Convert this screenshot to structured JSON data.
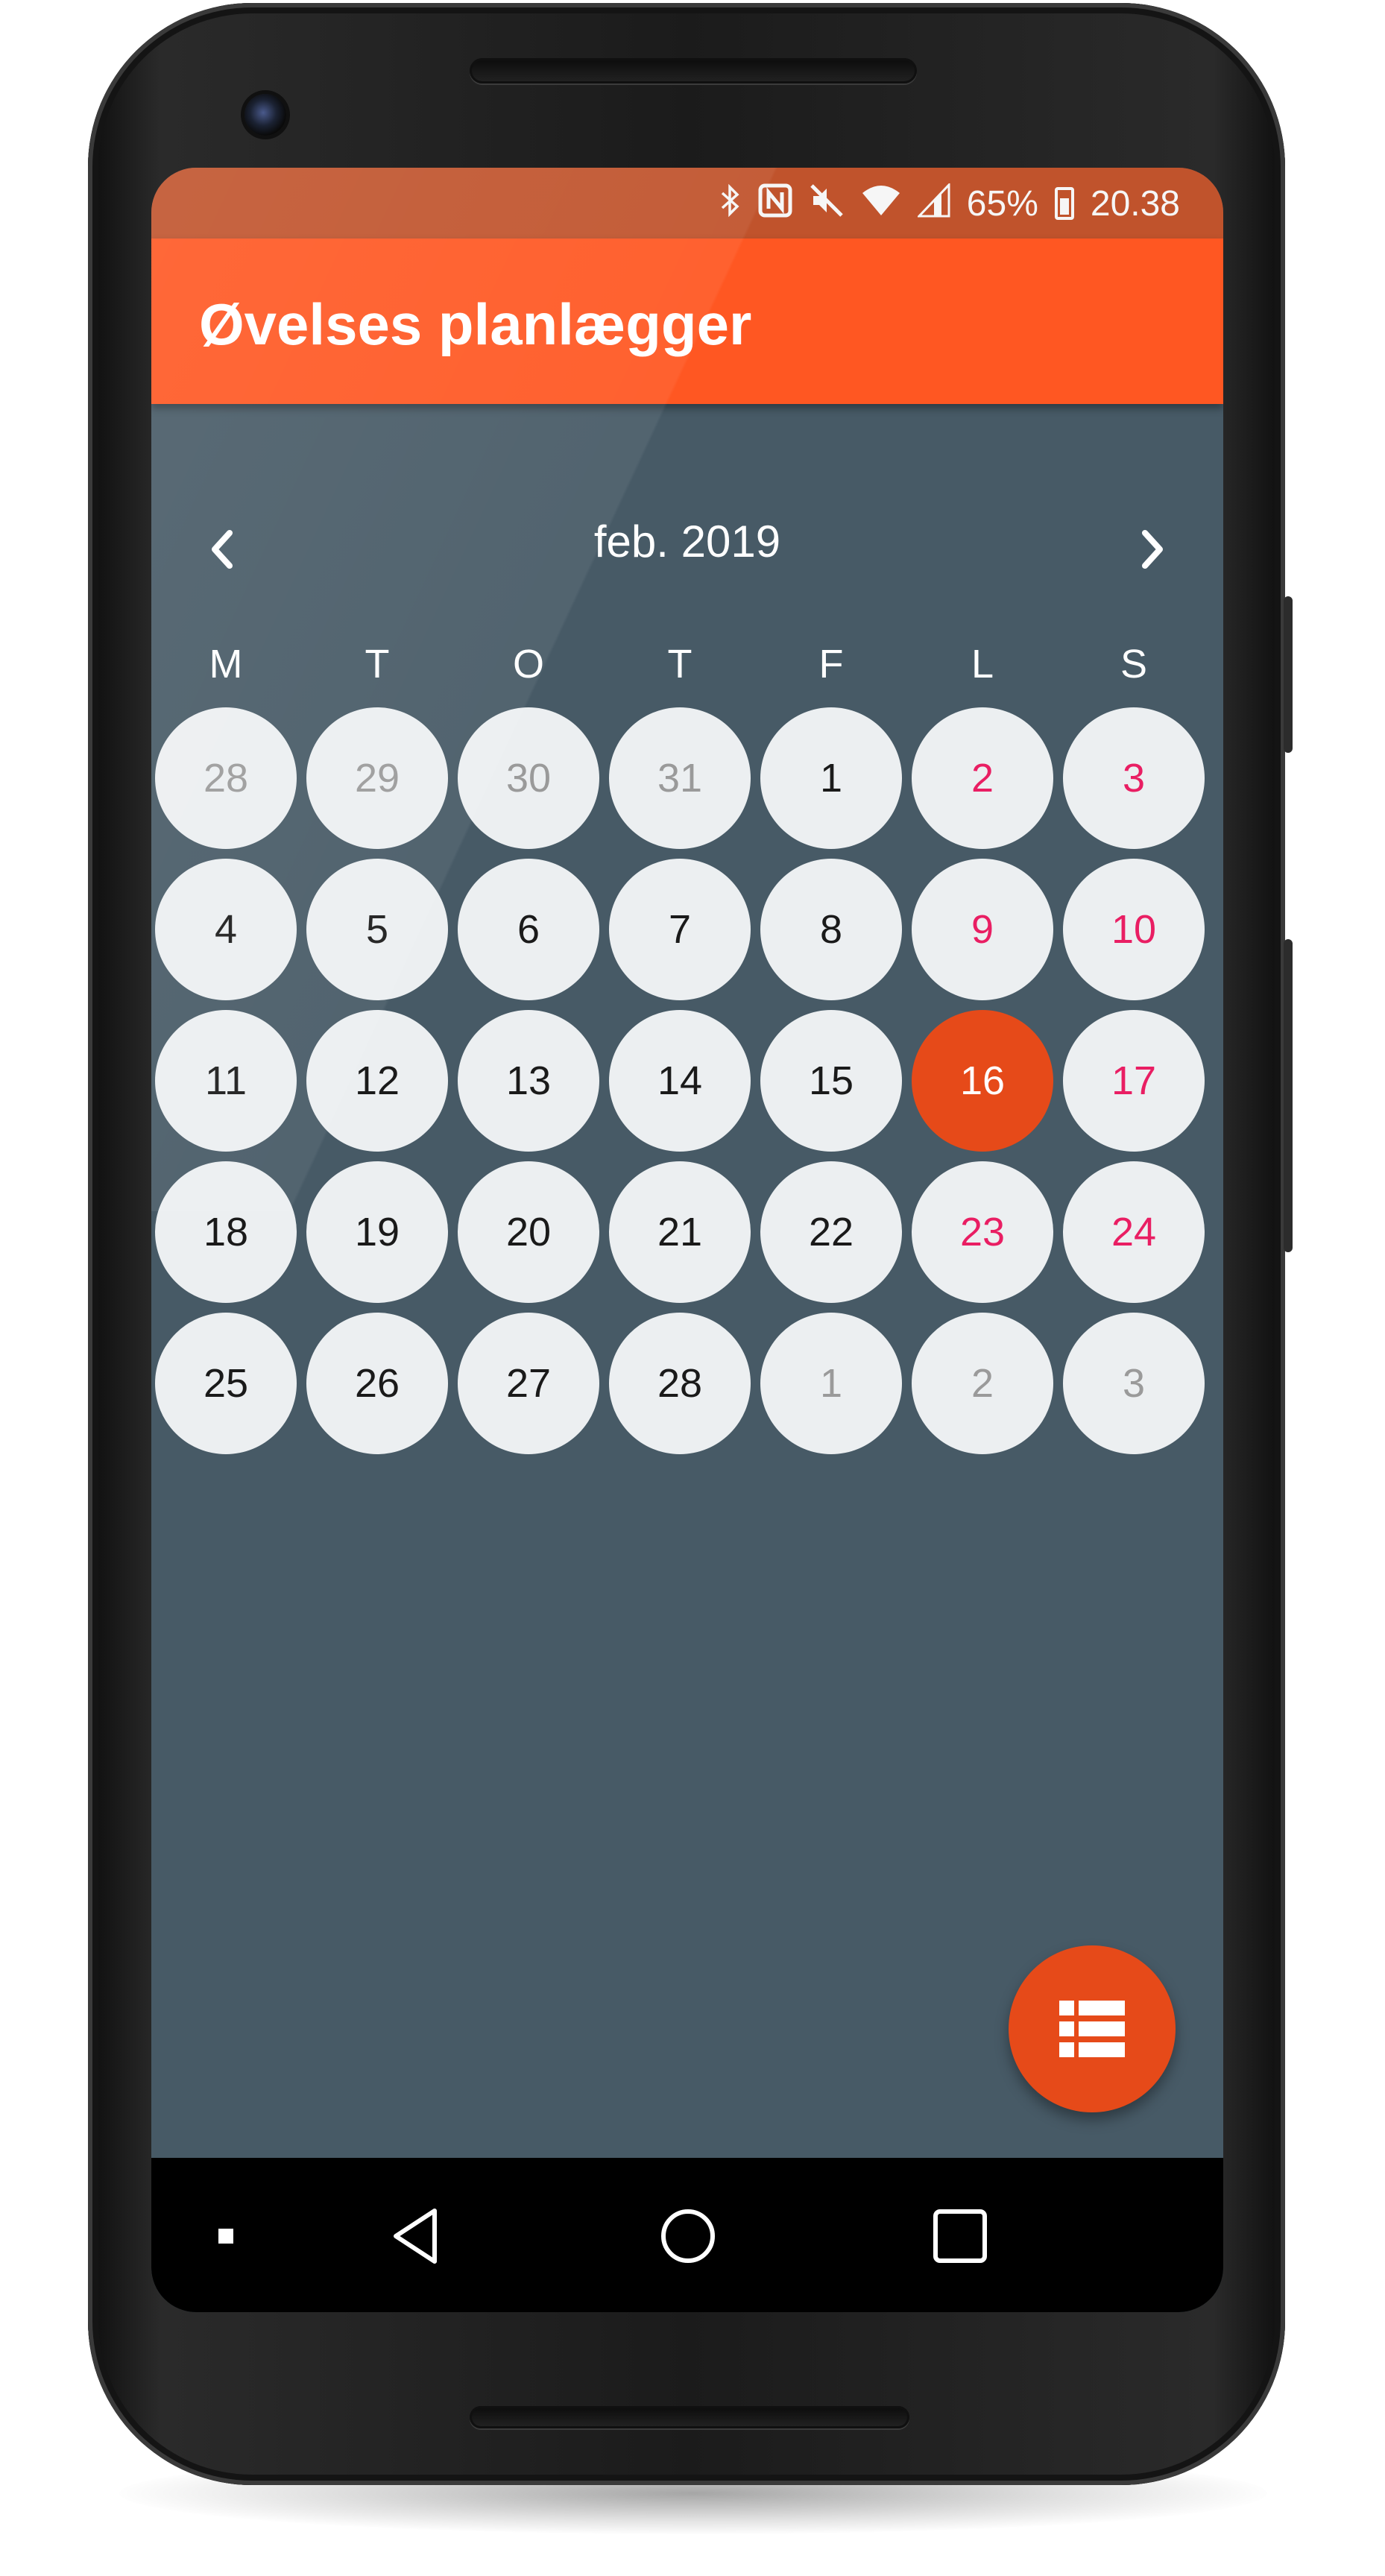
{
  "status_bar": {
    "battery_percent": "65%",
    "time": "20.38",
    "icons": [
      "bluetooth-icon",
      "nfc-icon",
      "mute-icon",
      "wifi-icon",
      "signal-icon",
      "battery-icon"
    ]
  },
  "app_bar": {
    "title": "Øvelses planlægger"
  },
  "calendar": {
    "month_label": "feb. 2019",
    "prev_icon": "chevron-left-icon",
    "next_icon": "chevron-right-icon",
    "weekdays": [
      "M",
      "T",
      "O",
      "T",
      "F",
      "L",
      "S"
    ],
    "weeks": [
      [
        {
          "label": "28",
          "state": "outside"
        },
        {
          "label": "29",
          "state": "outside"
        },
        {
          "label": "30",
          "state": "outside"
        },
        {
          "label": "31",
          "state": "outside"
        },
        {
          "label": "1",
          "state": "normal"
        },
        {
          "label": "2",
          "state": "weekend"
        },
        {
          "label": "3",
          "state": "weekend"
        }
      ],
      [
        {
          "label": "4",
          "state": "normal"
        },
        {
          "label": "5",
          "state": "normal"
        },
        {
          "label": "6",
          "state": "normal"
        },
        {
          "label": "7",
          "state": "normal"
        },
        {
          "label": "8",
          "state": "normal"
        },
        {
          "label": "9",
          "state": "weekend"
        },
        {
          "label": "10",
          "state": "weekend"
        }
      ],
      [
        {
          "label": "11",
          "state": "normal"
        },
        {
          "label": "12",
          "state": "normal"
        },
        {
          "label": "13",
          "state": "normal"
        },
        {
          "label": "14",
          "state": "normal"
        },
        {
          "label": "15",
          "state": "normal"
        },
        {
          "label": "16",
          "state": "selected"
        },
        {
          "label": "17",
          "state": "weekend"
        }
      ],
      [
        {
          "label": "18",
          "state": "normal"
        },
        {
          "label": "19",
          "state": "normal"
        },
        {
          "label": "20",
          "state": "normal"
        },
        {
          "label": "21",
          "state": "normal"
        },
        {
          "label": "22",
          "state": "normal"
        },
        {
          "label": "23",
          "state": "weekend"
        },
        {
          "label": "24",
          "state": "weekend"
        }
      ],
      [
        {
          "label": "25",
          "state": "normal"
        },
        {
          "label": "26",
          "state": "normal"
        },
        {
          "label": "27",
          "state": "normal"
        },
        {
          "label": "28",
          "state": "normal"
        },
        {
          "label": "1",
          "state": "outside"
        },
        {
          "label": "2",
          "state": "outside"
        },
        {
          "label": "3",
          "state": "outside"
        }
      ]
    ]
  },
  "fab": {
    "icon": "list-icon"
  },
  "nav_bar": {
    "icons": [
      "dot-icon",
      "back-icon",
      "home-icon",
      "recents-icon"
    ]
  },
  "colors": {
    "status_bar": "#c0532c",
    "app_bar": "#ff5722",
    "background": "#475a66",
    "day_circle": "#eceff1",
    "selected_day": "#e64a19",
    "weekend_text": "#e91e63",
    "outside_text": "#9a9a9a",
    "fab": "#e64a19"
  }
}
